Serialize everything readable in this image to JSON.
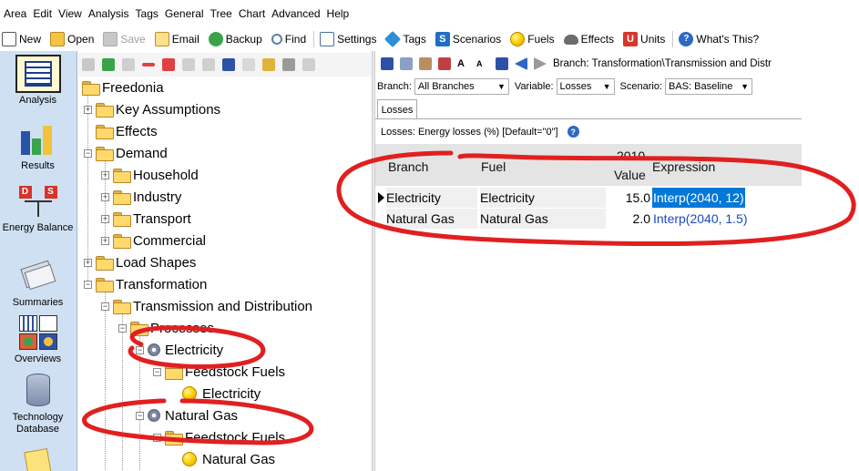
{
  "menu": [
    "Area",
    "Edit",
    "View",
    "Analysis",
    "Tags",
    "General",
    "Tree",
    "Chart",
    "Advanced",
    "Help"
  ],
  "toolbar": {
    "new": "New",
    "open": "Open",
    "save": "Save",
    "email": "Email",
    "backup": "Backup",
    "find": "Find",
    "settings": "Settings",
    "tags": "Tags",
    "scenarios": "Scenarios",
    "fuels": "Fuels",
    "effects": "Effects",
    "units": "Units",
    "whats_this": "What's This?"
  },
  "views": {
    "analysis": "Analysis",
    "results": "Results",
    "energy_balance": "Energy Balance",
    "summaries": "Summaries",
    "overviews": "Overviews",
    "technology_database": "Technology Database"
  },
  "tree": {
    "root": "Freedonia",
    "key_assumptions": "Key Assumptions",
    "effects": "Effects",
    "demand": "Demand",
    "household": "Household",
    "industry": "Industry",
    "transport": "Transport",
    "commercial": "Commercial",
    "load_shapes": "Load Shapes",
    "transformation": "Transformation",
    "td": "Transmission and Distribution",
    "processes": "Processes",
    "electricity": "Electricity",
    "feedstock_fuels_1": "Feedstock Fuels",
    "electricity_fuel": "Electricity",
    "natural_gas": "Natural Gas",
    "feedstock_fuels_2": "Feedstock Fuels",
    "natural_gas_fuel": "Natural Gas"
  },
  "breadcrumb": "Branch: Transformation\\Transmission and Distr",
  "selectors": {
    "branch_label": "Branch:",
    "branch_value": "All Branches",
    "variable_label": "Variable:",
    "variable_value": "Losses",
    "scenario_label": "Scenario:",
    "scenario_value": "BAS: Baseline"
  },
  "tab": "Losses",
  "variable_description": "Losses: Energy losses (%) [Default=\"0\"]",
  "grid": {
    "headers": {
      "branch": "Branch",
      "fuel": "Fuel",
      "year": "2010",
      "value": "Value",
      "expression": "Expression"
    },
    "rows": [
      {
        "branch": "Electricity",
        "fuel": "Electricity",
        "value": "15.0",
        "expression": "Interp(2040, 12)"
      },
      {
        "branch": "Natural Gas",
        "fuel": "Natural Gas",
        "value": "2.0",
        "expression": "Interp(2040, 1.5)"
      }
    ]
  },
  "colors": {
    "annotation": "#e02020",
    "selection": "#0078d7",
    "expression_text": "#1a47c8",
    "viewbar_bg": "#cfe0f3"
  }
}
